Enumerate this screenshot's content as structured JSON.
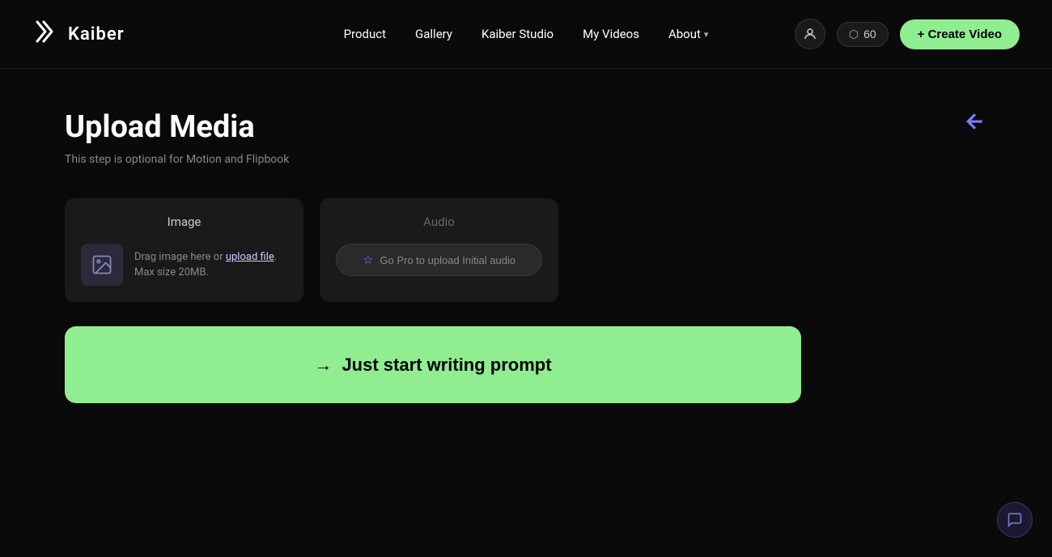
{
  "navbar": {
    "logo_text": "Kaiber",
    "logo_icon": "✕K",
    "nav_links": [
      {
        "label": "Product",
        "id": "product"
      },
      {
        "label": "Gallery",
        "id": "gallery"
      },
      {
        "label": "Kaiber Studio",
        "id": "kaiber-studio"
      },
      {
        "label": "My Videos",
        "id": "my-videos"
      },
      {
        "label": "About",
        "id": "about"
      }
    ],
    "credits_count": "60",
    "create_video_label": "+ Create Video"
  },
  "main": {
    "title": "Upload Media",
    "subtitle": "This step is optional for Motion and Flipbook",
    "image_card": {
      "title": "Image",
      "drag_text": "Drag image here or ",
      "upload_link": "upload file",
      "drag_text_end": ".",
      "max_size": "Max size 20MB."
    },
    "audio_card": {
      "title": "Audio",
      "go_pro_label": "Go Pro to upload Initial audio"
    },
    "start_writing_btn": "Just start writing prompt",
    "arrow": "→"
  }
}
